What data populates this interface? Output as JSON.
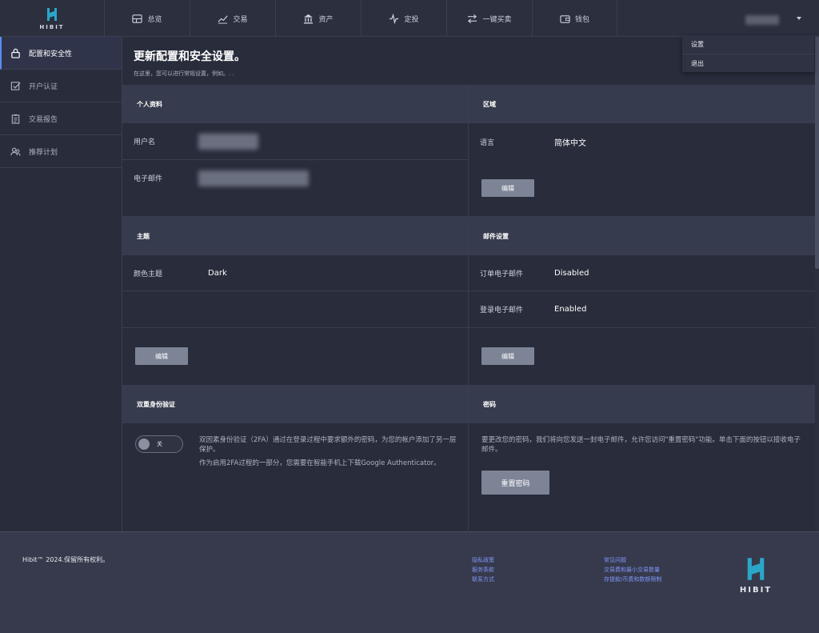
{
  "brand": {
    "name": "HIBIT",
    "accent": "#2aa6c9"
  },
  "nav": [
    {
      "label": "总览",
      "icon": "dashboard-icon"
    },
    {
      "label": "交易",
      "icon": "trend-chart-icon"
    },
    {
      "label": "资产",
      "icon": "bank-icon"
    },
    {
      "label": "定投",
      "icon": "pulse-icon"
    },
    {
      "label": "一键买卖",
      "icon": "swap-arrows-icon"
    },
    {
      "label": "钱包",
      "icon": "wallet-icon"
    }
  ],
  "user_menu": {
    "items": [
      "设置",
      "退出"
    ]
  },
  "sidebar": {
    "items": [
      {
        "label": "配置和安全性",
        "icon": "lock-icon",
        "active": true
      },
      {
        "label": "开户认证",
        "icon": "checkbox-icon",
        "active": false
      },
      {
        "label": "交易报告",
        "icon": "clipboard-icon",
        "active": false
      },
      {
        "label": "推荐计划",
        "icon": "users-icon",
        "active": false
      }
    ]
  },
  "page": {
    "title": "更新配置和安全设置。",
    "subtitle": "在这里，您可以进行常规设置，例如。. ."
  },
  "profile": {
    "heading": "个人资料",
    "username_label": "用户名",
    "email_label": "电子邮件"
  },
  "region": {
    "heading": "区域",
    "language_label": "语言",
    "language_value": "简体中文",
    "edit_label": "编辑"
  },
  "theme": {
    "heading": "主题",
    "color_label": "颜色主题",
    "color_value": "Dark",
    "edit_label": "编辑"
  },
  "mail_settings": {
    "heading": "邮件设置",
    "order_label": "订单电子邮件",
    "order_value": "Disabled",
    "login_label": "登录电子邮件",
    "login_value": "Enabled",
    "edit_label": "编辑"
  },
  "two_fa": {
    "heading": "双重身份验证",
    "toggle_label": "关",
    "toggle_on": false,
    "desc1": "双因素身份验证（2FA）通过在登录过程中要求额外的密码，为您的帐户添加了另一层保护。",
    "desc2": "作为启用2FA过程的一部分，您需要在智能手机上下载Google Authenticator。"
  },
  "password": {
    "heading": "密码",
    "desc": "要更改您的密码，我们将向您发送一封电子邮件，允许您访问\"重置密码\"功能。单击下面的按钮以接收电子邮件。",
    "reset_label": "重置密码"
  },
  "footer": {
    "copyright": "Hibit™ 2024.保留所有权利。",
    "links_col1": [
      "隐私政策",
      "服务条款",
      "联系方式"
    ],
    "links_col2": [
      "常见问题",
      "交易费和最小交易数量",
      "存提款/币费和数额限制"
    ],
    "logo_text": "HIBIT"
  }
}
